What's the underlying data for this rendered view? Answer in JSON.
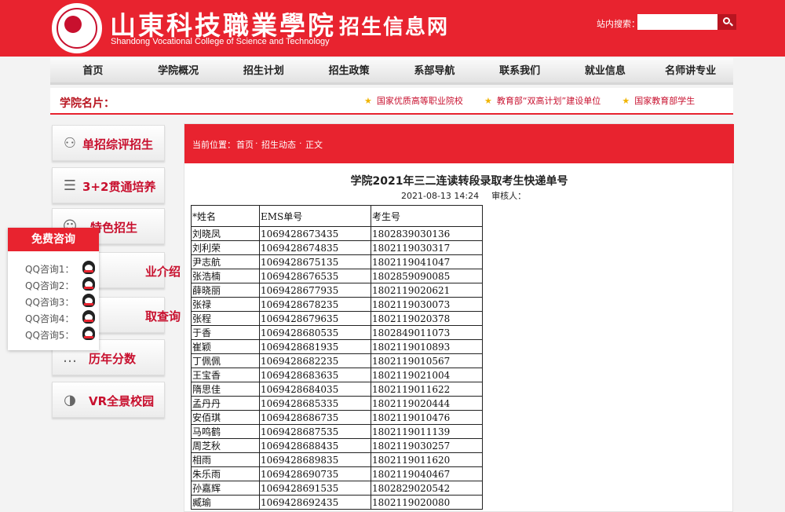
{
  "header": {
    "school_name_cn": "山東科技職業學院",
    "school_name_en": "Shandong Vocational College of Science and Technology",
    "site_name": "招生信息网",
    "search_label": "站内搜索：",
    "search_value": ""
  },
  "nav": [
    "首页",
    "学院概况",
    "招生计划",
    "招生政策",
    "系部导航",
    "联系我们",
    "就业信息",
    "名师讲专业"
  ],
  "cards": {
    "label": "学院名片：",
    "items": [
      "国家优质高等职业院校",
      "教育部“双高计划”建设单位",
      "国家教育部学生"
    ]
  },
  "menu": [
    {
      "label": "单招综评招生",
      "icon": "people-icon"
    },
    {
      "label": "3+2贯通培养",
      "icon": "books-icon"
    },
    {
      "label": "特色招生",
      "icon": "group-icon"
    },
    {
      "label": "业介绍",
      "icon": "book-icon"
    },
    {
      "label": "取查询",
      "icon": "search-icon"
    },
    {
      "label": "历年分数",
      "icon": "chat-icon"
    },
    {
      "label": "VR全景校园",
      "icon": "vr-headset-icon"
    }
  ],
  "consult": {
    "title": "免费咨询",
    "items": [
      "QQ咨询1：",
      "QQ咨询2：",
      "QQ咨询3：",
      "QQ咨询4：",
      "QQ咨询5："
    ]
  },
  "breadcrumb": {
    "prefix": "当前位置：",
    "home": "首页",
    "sep": "·",
    "section": "招生动态",
    "current": "正文"
  },
  "article": {
    "title": "学院2021年三二连读转段录取考生快递单号",
    "date": "2021-08-13 14:24",
    "auditor": "审核人："
  },
  "table": {
    "headers": [
      "*姓名",
      "EMS单号",
      "考生号"
    ],
    "rows": [
      [
        "刘晓凤",
        "1069428673435",
        "1802839030136"
      ],
      [
        "刘利荣",
        "1069428674835",
        "1802119030317"
      ],
      [
        "尹志航",
        "1069428675135",
        "1802119041047"
      ],
      [
        "张浩楠",
        "1069428676535",
        "1802859090085"
      ],
      [
        "薛晓丽",
        "1069428677935",
        "1802119020621"
      ],
      [
        "张禄",
        "1069428678235",
        "1802119030073"
      ],
      [
        "张程",
        "1069428679635",
        "1802119020378"
      ],
      [
        "于香",
        "1069428680535",
        "1802849011073"
      ],
      [
        "崔颖",
        "1069428681935",
        "1802119010893"
      ],
      [
        "丁佩佩",
        "1069428682235",
        "1802119010567"
      ],
      [
        "王宝香",
        "1069428683635",
        "1802119021004"
      ],
      [
        "隋思佳",
        "1069428684035",
        "1802119011622"
      ],
      [
        "孟丹丹",
        "1069428685335",
        "1802119020444"
      ],
      [
        "安佰琪",
        "1069428686735",
        "1802119010476"
      ],
      [
        "马鸣鹤",
        "1069428687535",
        "1802119011139"
      ],
      [
        "周芝秋",
        "1069428688435",
        "1802119030257"
      ],
      [
        "相雨",
        "1069428689835",
        "1802119011620"
      ],
      [
        "朱乐雨",
        "1069428690735",
        "1802119040467"
      ],
      [
        "孙嘉辉",
        "1069428691535",
        "1802829020542"
      ],
      [
        "臧瑜",
        "1069428692435",
        "1802119020080"
      ]
    ]
  }
}
